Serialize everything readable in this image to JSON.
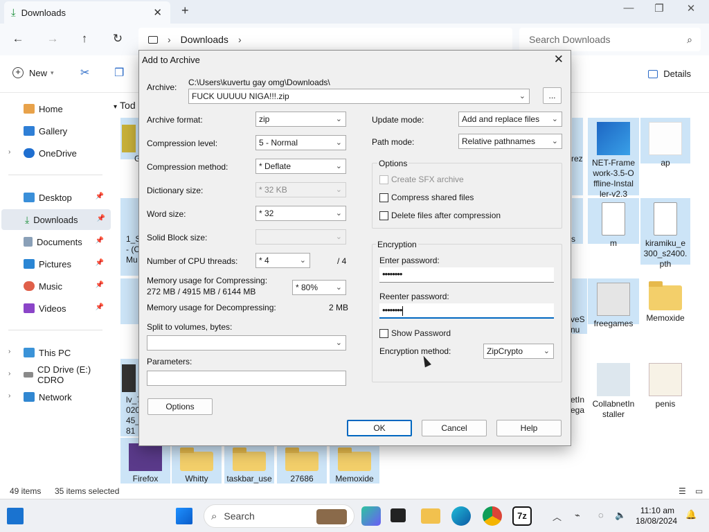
{
  "explorer": {
    "tab_title": "Downloads",
    "address_current": "Downloads",
    "search_placeholder": "Search Downloads",
    "toolbar": {
      "new_label": "New",
      "details_label": "Details"
    },
    "section_header_partial": "Tod",
    "sidebar": {
      "quick": [
        {
          "label": "Home"
        },
        {
          "label": "Gallery"
        },
        {
          "label": "OneDrive"
        }
      ],
      "pinned": [
        {
          "label": "Desktop"
        },
        {
          "label": "Downloads"
        },
        {
          "label": "Documents"
        },
        {
          "label": "Pictures"
        },
        {
          "label": "Music"
        },
        {
          "label": "Videos"
        }
      ],
      "devices": [
        {
          "label": "This PC"
        },
        {
          "label": "CD Drive (E:) CDRO"
        },
        {
          "label": "Network"
        }
      ]
    },
    "files": [
      {
        "label": "NET-Frame work-3.5-O ffline-Instal ler-v2.3"
      },
      {
        "label": "ap"
      },
      {
        "label": "m"
      },
      {
        "label": "kiramiku_e 300_s2400. pth"
      },
      {
        "label": "freegames"
      },
      {
        "label": "Memoxide"
      },
      {
        "label": "CollabnetIn staller"
      },
      {
        "label": "penis"
      },
      {
        "label": "Firefox"
      },
      {
        "label": "Whitty"
      },
      {
        "label": "taskbar_use"
      },
      {
        "label": "27686"
      },
      {
        "label": "Memoxide"
      }
    ],
    "partial_labels": [
      "rez",
      "s",
      "veS nu",
      "etIn ega",
      "G",
      "1_S - (C Mu",
      "lv_7 020 45_ 81"
    ],
    "status": {
      "items": "49 items",
      "selected": "35 items selected"
    }
  },
  "dialog": {
    "title": "Add to Archive",
    "archive_label": "Archive:",
    "archive_path": "C:\\Users\\kuvertu gay omg\\Downloads\\",
    "archive_name": "FUCK UUUUU NIGA!!!.zip",
    "browse_label": "...",
    "left": {
      "format_label": "Archive format:",
      "format_value": "zip",
      "level_label": "Compression level:",
      "level_value": "5 - Normal",
      "method_label": "Compression method:",
      "method_value": "* Deflate",
      "dict_label": "Dictionary size:",
      "dict_value": "* 32 KB",
      "word_label": "Word size:",
      "word_value": "* 32",
      "solid_label": "Solid Block size:",
      "solid_value": "",
      "threads_label": "Number of CPU threads:",
      "threads_value": "* 4",
      "threads_max": "/ 4",
      "mem_comp_label": "Memory usage for Compressing:",
      "mem_comp_value": "272 MB / 4915 MB / 6144 MB",
      "mem_comp_pct": "* 80%",
      "mem_decomp_label": "Memory usage for Decompressing:",
      "mem_decomp_value": "2 MB",
      "split_label": "Split to volumes, bytes:",
      "split_value": "",
      "params_label": "Parameters:",
      "params_value": "",
      "options_button": "Options"
    },
    "right": {
      "update_label": "Update mode:",
      "update_value": "Add and replace files",
      "path_label": "Path mode:",
      "path_value": "Relative pathnames",
      "options_group": "Options",
      "sfx_label": "Create SFX archive",
      "shared_label": "Compress shared files",
      "delete_label": "Delete files after compression",
      "encryption_group": "Encryption",
      "enter_pw_label": "Enter password:",
      "enter_pw_value": "••••••••",
      "reenter_pw_label": "Reenter password:",
      "reenter_pw_value": "••••••••",
      "show_pw_label": "Show Password",
      "enc_method_label": "Encryption method:",
      "enc_method_value": "ZipCrypto"
    },
    "buttons": {
      "ok": "OK",
      "cancel": "Cancel",
      "help": "Help"
    }
  },
  "taskbar": {
    "search_label": "Search",
    "time": "11:10 am",
    "date": "18/08/2024",
    "app_7z_label": "7z"
  },
  "colors": {
    "accent": "#0067c0",
    "selection": "#cce4f7",
    "folder": "#f3cf6a"
  }
}
